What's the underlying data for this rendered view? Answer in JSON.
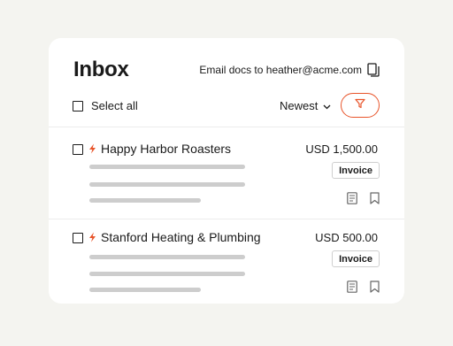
{
  "header": {
    "title": "Inbox",
    "email_text": "Email docs to heather@acme.com",
    "email_icon": "document-copy-icon"
  },
  "toolbar": {
    "select_all_label": "Select all",
    "sort_label": "Newest",
    "sort_icon": "chevron-down-icon",
    "filter_icon": "filter-icon"
  },
  "colors": {
    "accent": "#e8542a",
    "background": "#f4f4f0",
    "card": "#ffffff",
    "skeleton": "#cdcdcd"
  },
  "items": [
    {
      "name": "Happy Harbor Roasters",
      "amount": "USD 1,500.00",
      "badge": "Invoice",
      "priority_icon": "lightning-bolt-icon",
      "actions": [
        "document-icon",
        "bookmark-icon"
      ]
    },
    {
      "name": "Stanford Heating & Plumbing",
      "amount": "USD 500.00",
      "badge": "Invoice",
      "priority_icon": "lightning-bolt-icon",
      "actions": [
        "document-icon",
        "bookmark-icon"
      ]
    }
  ]
}
